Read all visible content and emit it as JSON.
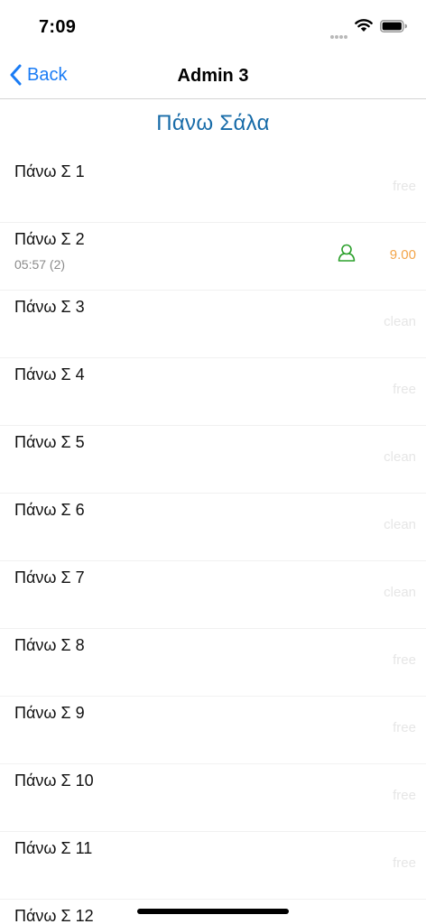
{
  "status_bar": {
    "time": "7:09"
  },
  "nav": {
    "back_label": "Back",
    "title": "Admin 3"
  },
  "section": {
    "title": "Πάνω Σάλα"
  },
  "colors": {
    "accent": "#1a7cf5",
    "section_title": "#176ba8",
    "occupied_time": "#f3a54a",
    "status_idle": "#e6e6e6",
    "user_icon": "#2ca02c"
  },
  "tables": [
    {
      "name": "Πάνω Σ 1",
      "status": "free"
    },
    {
      "name": "Πάνω Σ 2",
      "sub": "05:57 (2)",
      "status": "9.00",
      "icon": "user-icon"
    },
    {
      "name": "Πάνω Σ 3",
      "status": "clean"
    },
    {
      "name": "Πάνω Σ 4",
      "status": "free"
    },
    {
      "name": "Πάνω Σ 5",
      "status": "clean"
    },
    {
      "name": "Πάνω Σ 6",
      "status": "clean"
    },
    {
      "name": "Πάνω Σ 7",
      "status": "clean"
    },
    {
      "name": "Πάνω Σ 8",
      "status": "free"
    },
    {
      "name": "Πάνω Σ 9",
      "status": "free"
    },
    {
      "name": "Πάνω Σ 10",
      "status": "free"
    },
    {
      "name": "Πάνω Σ 11",
      "status": "free"
    },
    {
      "name": "Πάνω Σ 12",
      "status": ""
    }
  ]
}
